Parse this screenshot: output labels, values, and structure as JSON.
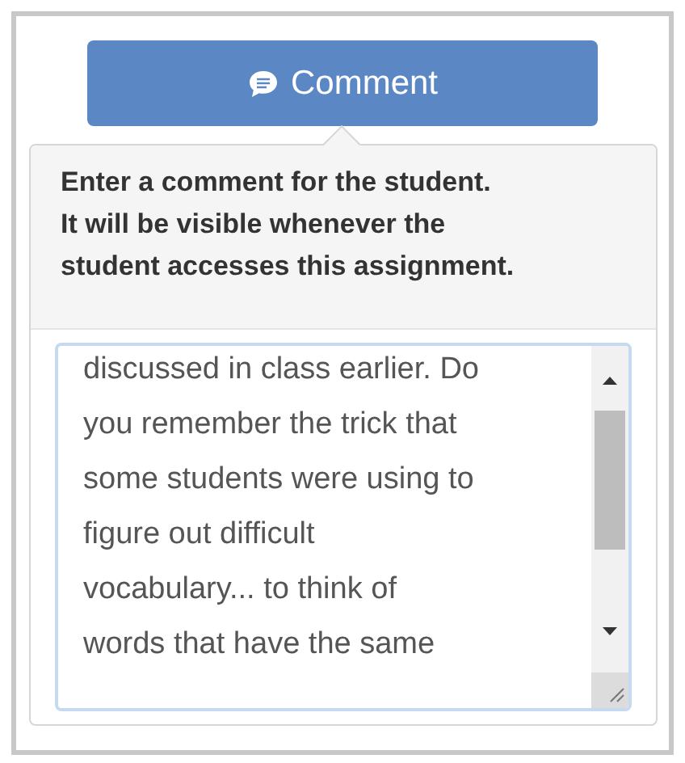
{
  "comment_button": {
    "label": "Comment"
  },
  "popover": {
    "prompt": "Enter a comment for the student.\nIt will be visible whenever the\nstudent accesses this assignment.",
    "comment_field": {
      "value": "discussed in class earlier. Do\nyou remember the trick that\nsome students were using to\nfigure out difficult\nvocabulary... to think of\nwords that have the same"
    }
  }
}
